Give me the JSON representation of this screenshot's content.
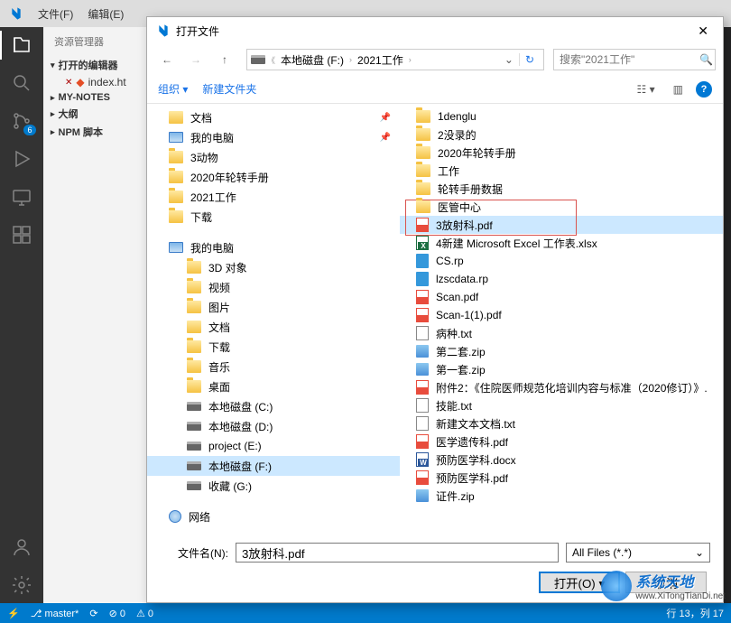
{
  "vscode": {
    "menu": {
      "file": "文件(F)",
      "edit": "编辑(E)"
    },
    "sidebar_title": "资源管理器",
    "sections": {
      "open_editors": "打开的编辑器",
      "my_notes": "MY-NOTES",
      "outline": "大纲",
      "npm": "NPM 脚本"
    },
    "open_file": "index.ht",
    "scm_badge": "6",
    "status": {
      "branch": "master*",
      "sync": "⟳",
      "errors": "⊘ 0",
      "warnings": "⚠ 0",
      "cursor": "行 13，列 17"
    }
  },
  "dialog": {
    "title": "打开文件",
    "breadcrumb": {
      "drive": "本地磁盘 (F:)",
      "folder": "2021工作"
    },
    "search_placeholder": "搜索\"2021工作\"",
    "toolbar": {
      "organize": "组织",
      "new_folder": "新建文件夹"
    },
    "nav_pane": [
      {
        "label": "文档",
        "icon": "docfolder",
        "pinned": true
      },
      {
        "label": "我的电脑",
        "icon": "pc",
        "pinned": true
      },
      {
        "label": "3动物",
        "icon": "folder"
      },
      {
        "label": "2020年轮转手册",
        "icon": "folder"
      },
      {
        "label": "2021工作",
        "icon": "folder"
      },
      {
        "label": "下载",
        "icon": "folder"
      },
      {
        "spacer": true
      },
      {
        "label": "我的电脑",
        "icon": "pc",
        "header": true
      },
      {
        "label": "3D 对象",
        "icon": "folder",
        "indent": true
      },
      {
        "label": "视频",
        "icon": "folder",
        "indent": true
      },
      {
        "label": "图片",
        "icon": "folder",
        "indent": true
      },
      {
        "label": "文档",
        "icon": "docfolder",
        "indent": true
      },
      {
        "label": "下载",
        "icon": "folder",
        "indent": true
      },
      {
        "label": "音乐",
        "icon": "folder",
        "indent": true
      },
      {
        "label": "桌面",
        "icon": "folder",
        "indent": true
      },
      {
        "label": "本地磁盘 (C:)",
        "icon": "drive",
        "indent": true
      },
      {
        "label": "本地磁盘 (D:)",
        "icon": "drive",
        "indent": true
      },
      {
        "label": "project (E:)",
        "icon": "drive",
        "indent": true
      },
      {
        "label": "本地磁盘 (F:)",
        "icon": "drive",
        "indent": true,
        "selected": true
      },
      {
        "label": "收藏 (G:)",
        "icon": "drive",
        "indent": true
      },
      {
        "spacer": true
      },
      {
        "label": "网络",
        "icon": "net",
        "header": true
      }
    ],
    "files": [
      {
        "name": "1denglu",
        "icon": "folder"
      },
      {
        "name": "2没录的",
        "icon": "folder"
      },
      {
        "name": "2020年轮转手册",
        "icon": "folder"
      },
      {
        "name": "工作",
        "icon": "folder"
      },
      {
        "name": "轮转手册数据",
        "icon": "folder"
      },
      {
        "name": "医管中心",
        "icon": "folder",
        "redbox_start": true
      },
      {
        "name": "3放射科.pdf",
        "icon": "pdf",
        "selected": true,
        "redbox_end": true
      },
      {
        "name": "4新建 Microsoft Excel 工作表.xlsx",
        "icon": "xlsx"
      },
      {
        "name": "CS.rp",
        "icon": "rp"
      },
      {
        "name": "lzscdata.rp",
        "icon": "rp"
      },
      {
        "name": "Scan.pdf",
        "icon": "pdf"
      },
      {
        "name": "Scan-1(1).pdf",
        "icon": "pdf"
      },
      {
        "name": "病种.txt",
        "icon": "txt"
      },
      {
        "name": "第二套.zip",
        "icon": "zip"
      },
      {
        "name": "第一套.zip",
        "icon": "zip"
      },
      {
        "name": "附件2：《住院医师规范化培训内容与标准（2020修订）》.",
        "icon": "pdf"
      },
      {
        "name": "技能.txt",
        "icon": "txt"
      },
      {
        "name": "新建文本文档.txt",
        "icon": "txt"
      },
      {
        "name": "医学遗传科.pdf",
        "icon": "pdf"
      },
      {
        "name": "预防医学科.docx",
        "icon": "docx"
      },
      {
        "name": "预防医学科.pdf",
        "icon": "pdf"
      },
      {
        "name": "证件.zip",
        "icon": "zip"
      }
    ],
    "footer": {
      "filename_label": "文件名(N):",
      "filename_value": "3放射科.pdf",
      "filter": "All Files (*.*)",
      "open": "打开(O)",
      "cancel": "取消"
    }
  },
  "watermark": {
    "text": "系统天地",
    "url": "www.XiTongTianDi.net"
  }
}
